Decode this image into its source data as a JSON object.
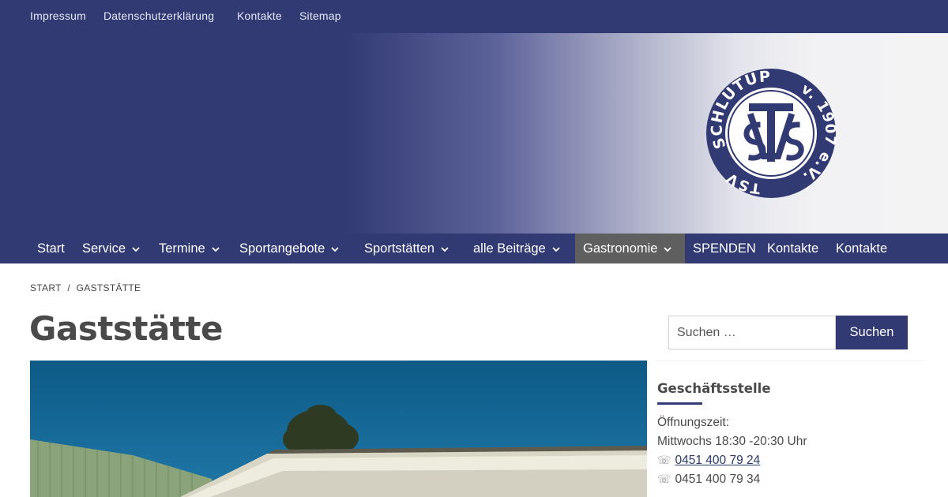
{
  "topbar": {
    "links": [
      {
        "label": "Impressum"
      },
      {
        "label": "Datenschutzerklärung"
      },
      {
        "label": "Kontakte"
      },
      {
        "label": "Sitemap"
      }
    ]
  },
  "logo": {
    "text_top": "SCHLUTUP",
    "text_right": "v. 1907 e.V.",
    "text_left": "TSV",
    "monogram": "TSV"
  },
  "nav": {
    "items": [
      {
        "label": "Start",
        "has_dropdown": false
      },
      {
        "label": "Service",
        "has_dropdown": true
      },
      {
        "label": "Termine",
        "has_dropdown": true
      },
      {
        "label": "Sportangebote",
        "has_dropdown": true
      },
      {
        "label": "Sportstätten",
        "has_dropdown": true
      },
      {
        "label": "alle Beiträge",
        "has_dropdown": true
      },
      {
        "label": "Gastronomie",
        "has_dropdown": true,
        "active": true
      },
      {
        "label": "SPENDEN",
        "has_dropdown": false
      },
      {
        "label": "Kontakte",
        "has_dropdown": false
      },
      {
        "label": "Kontakte",
        "has_dropdown": false
      }
    ]
  },
  "breadcrumb": {
    "home": "START",
    "separator": "/",
    "current": "GASTSTÄTTE"
  },
  "page": {
    "title": "Gaststätte"
  },
  "search": {
    "placeholder": "Suchen …",
    "button_label": "Suchen"
  },
  "sidebar": {
    "widget_title": "Geschäftsstelle",
    "hours_label": "Öffnungszeit:",
    "hours_value": "Mittwochs 18:30 -20:30 Uhr",
    "phone": "0451 400 79 24",
    "fax": "0451 400 79 34",
    "phone_icon": "☏"
  },
  "colors": {
    "brand": "#323a73",
    "active_nav": "#5f5f5f",
    "text": "#4a4a4a"
  }
}
